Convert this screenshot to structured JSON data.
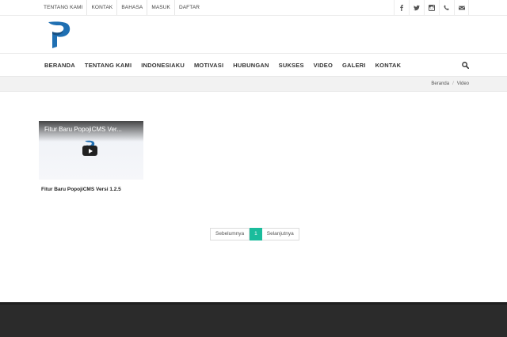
{
  "topbar": {
    "links": [
      "TENTANG KAMI",
      "KONTAK",
      "BAHASA",
      "MASUK",
      "DAFTAR"
    ],
    "social_icons": [
      "facebook-icon",
      "twitter-icon",
      "instagram-icon",
      "phone-icon",
      "mail-icon"
    ]
  },
  "logo": {
    "icon": "popojicms-logo",
    "color": "#1f6fb2"
  },
  "nav": {
    "items": [
      "BERANDA",
      "TENTANG KAMI",
      "INDONESIAKU",
      "MOTIVASI",
      "HUBUNGAN",
      "SUKSES",
      "VIDEO",
      "GALERI",
      "KONTAK"
    ],
    "search_icon": "search-icon"
  },
  "breadcrumb": {
    "home": "Beranda",
    "separator": "/",
    "current": "Video"
  },
  "videos": [
    {
      "thumb_title": "Fitur Baru PopojiCMS Ver...",
      "title": "Fitur Baru PopojiCMS Versi 1.2.5"
    }
  ],
  "pagination": {
    "prev": "Sebelumnya",
    "current": "1",
    "next": "Selanjutnya",
    "accent": "#1abc9c"
  },
  "footer": {
    "color": "#2b2b2b"
  }
}
